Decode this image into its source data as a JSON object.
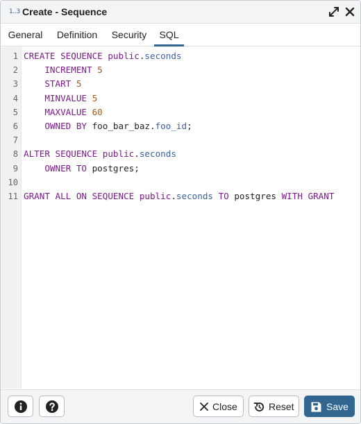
{
  "dialog": {
    "title_icon": "1..3",
    "title": "Create - Sequence",
    "icons": {
      "expand": "expand-icon",
      "close": "close-icon"
    }
  },
  "tabs": [
    {
      "label": "General",
      "active": false
    },
    {
      "label": "Definition",
      "active": false
    },
    {
      "label": "Security",
      "active": false
    },
    {
      "label": "SQL",
      "active": true
    }
  ],
  "editor": {
    "line_numbers": [
      "1",
      "2",
      "3",
      "4",
      "5",
      "6",
      "7",
      "8",
      "9",
      "10",
      "11"
    ],
    "lines": [
      [
        {
          "t": "CREATE SEQUENCE ",
          "c": "kw"
        },
        {
          "t": "public",
          "c": "kw"
        },
        {
          "t": ".",
          "c": ""
        },
        {
          "t": "seconds",
          "c": "prop"
        }
      ],
      [
        {
          "t": "    INCREMENT ",
          "c": "kw"
        },
        {
          "t": "5",
          "c": "num"
        }
      ],
      [
        {
          "t": "    START ",
          "c": "kw"
        },
        {
          "t": "5",
          "c": "num"
        }
      ],
      [
        {
          "t": "    MINVALUE ",
          "c": "kw"
        },
        {
          "t": "5",
          "c": "num"
        }
      ],
      [
        {
          "t": "    MAXVALUE ",
          "c": "kw"
        },
        {
          "t": "60",
          "c": "num"
        }
      ],
      [
        {
          "t": "    OWNED BY ",
          "c": "kw"
        },
        {
          "t": "foo_bar_baz.",
          "c": ""
        },
        {
          "t": "foo_id",
          "c": "prop"
        },
        {
          "t": ";",
          "c": ""
        }
      ],
      [],
      [
        {
          "t": "ALTER SEQUENCE ",
          "c": "kw"
        },
        {
          "t": "public",
          "c": "kw"
        },
        {
          "t": ".",
          "c": ""
        },
        {
          "t": "seconds",
          "c": "prop"
        }
      ],
      [
        {
          "t": "    OWNER TO ",
          "c": "kw"
        },
        {
          "t": "postgres;",
          "c": ""
        }
      ],
      [],
      [
        {
          "t": "GRANT ALL ON SEQUENCE ",
          "c": "kw"
        },
        {
          "t": "public",
          "c": "kw"
        },
        {
          "t": ".",
          "c": ""
        },
        {
          "t": "seconds",
          "c": "prop"
        },
        {
          "t": " TO ",
          "c": "kw"
        },
        {
          "t": "postgres ",
          "c": ""
        },
        {
          "t": "WITH GRANT",
          "c": "kw"
        }
      ]
    ]
  },
  "footer": {
    "info_icon": "info-icon",
    "help_icon": "help-icon",
    "close_label": "Close",
    "reset_label": "Reset",
    "save_label": "Save"
  },
  "colors": {
    "keyword": "#7b1a8a",
    "number": "#a35b1c",
    "property": "#3a5f9f",
    "accent": "#326690"
  }
}
